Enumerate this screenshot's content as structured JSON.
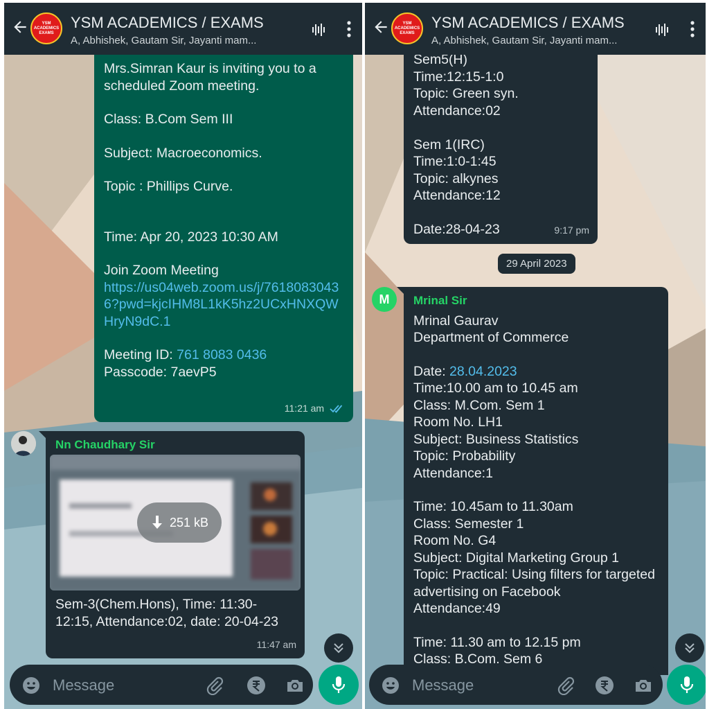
{
  "left": {
    "header": {
      "logo_text": "YSM ACADEMICS EXAMS",
      "title": "YSM ACADEMICS / EXAMS",
      "subtitle": "A, Abhishek, Gautam Sir, Jayanti mam..."
    },
    "outgoing_message": {
      "line1": "Mrs.Simran Kaur is inviting you to a scheduled Zoom meeting.",
      "class": "Class: B.Com Sem III",
      "subject": "Subject: Macroeconomics.",
      "topic": "Topic : Phillips Curve.",
      "time": "Time: Apr 20, 2023 10:30 AM",
      "join_label": "Join Zoom Meeting",
      "join_link": "https://us04web.zoom.us/j/76180830436?pwd=kjcIHM8L1kK5hz2UCxHNXQWHryN9dC.1",
      "meeting_id_label": "Meeting ID: ",
      "meeting_id": "761 8083 0436",
      "passcode": "Passcode: 7aevP5",
      "timestamp": "11:21 am"
    },
    "incoming_message": {
      "sender": "Nn Chaudhary Sir",
      "download_size": "251 kB",
      "caption": "Sem-3(Chem.Hons), Time: 11:30-12:15, Attendance:02, date: 20-04-23",
      "timestamp": "11:47 am"
    },
    "input": {
      "placeholder": "Message"
    }
  },
  "right": {
    "header": {
      "logo_text": "YSM ACADEMICS EXAMS",
      "title": "YSM ACADEMICS / EXAMS",
      "subtitle": "A, Abhishek, Gautam Sir, Jayanti mam..."
    },
    "prev_message": {
      "text": "Sem5(H)\nTime:12:15-1:0\nTopic: Green syn.\nAttendance:02\n\nSem 1(IRC)\nTime:1:0-1:45\nTopic: alkynes\nAttendance:12\n\nDate:28-04-23",
      "timestamp": "9:17 pm"
    },
    "date_chip": "29 April 2023",
    "message": {
      "avatar_letter": "M",
      "sender": "Mrinal Sir",
      "intro": "Mrinal Gaurav\nDepartment of Commerce",
      "date_label": "Date: ",
      "date_value": "28.04.2023",
      "block1": "Time:10.00 am to 10.45 am\nClass: M.Com. Sem 1\nRoom No. LH1\nSubject: Business Statistics\nTopic: Probability\nAttendance:1",
      "block2": "Time: 10.45am to 11.30am\nClass: Semester 1\nRoom No. G4\nSubject: Digital Marketing Group 1\nTopic: Practical: Using filters for targeted advertising on Facebook\nAttendance:49",
      "block3": "Time: 11.30 am to 12.15 pm\nClass: B.Com. Sem 6"
    },
    "input": {
      "placeholder": "Message"
    }
  },
  "colors": {
    "header_bg": "#1f2c34",
    "outgoing_bubble": "#005c4b",
    "incoming_bubble": "#1f2c34",
    "link": "#53bdeb",
    "sender_name": "#25d366",
    "mic_button": "#00a884"
  },
  "icons": [
    "back-arrow-icon",
    "voice-call-icon",
    "more-options-icon",
    "emoji-icon",
    "attach-icon",
    "rupee-icon",
    "camera-icon",
    "mic-icon",
    "scroll-down-icon",
    "download-icon",
    "read-ticks-icon"
  ]
}
